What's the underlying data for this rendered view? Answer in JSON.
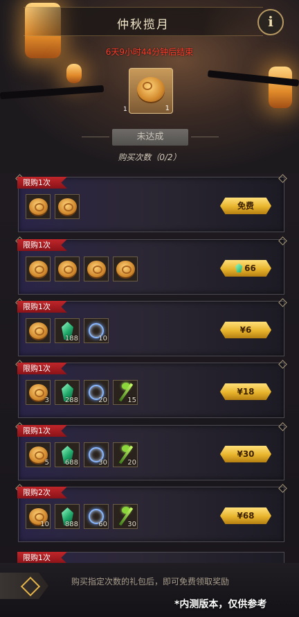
{
  "header": {
    "title": "仲秋揽月"
  },
  "event": {
    "countdown": "6天9小时44分钟后结束",
    "reward_count": "1",
    "reward_small": "1",
    "status": "未达成",
    "buy_count": "购买次数（0/2）"
  },
  "packs": [
    {
      "limit": "限购1次",
      "price": "免费",
      "items": [
        {
          "icon": "mooncake-icon",
          "qty": ""
        },
        {
          "icon": "mooncake-icon",
          "qty": ""
        }
      ]
    },
    {
      "limit": "限购1次",
      "price": "66",
      "price_icon": "gem-icon",
      "items": [
        {
          "icon": "mooncake-icon",
          "qty": ""
        },
        {
          "icon": "mooncake-icon",
          "qty": ""
        },
        {
          "icon": "mooncake-icon",
          "qty": ""
        },
        {
          "icon": "mooncake-icon",
          "qty": ""
        }
      ]
    },
    {
      "limit": "限购1次",
      "price": "¥6",
      "items": [
        {
          "icon": "mooncake-icon",
          "qty": ""
        },
        {
          "icon": "gem-icon",
          "qty": "188"
        },
        {
          "icon": "orb-icon",
          "qty": "10"
        }
      ]
    },
    {
      "limit": "限购1次",
      "price": "¥18",
      "items": [
        {
          "icon": "mooncake-icon",
          "qty": "3"
        },
        {
          "icon": "gem-icon",
          "qty": "288"
        },
        {
          "icon": "orb-icon",
          "qty": "20"
        },
        {
          "icon": "staff-icon",
          "qty": "15"
        }
      ]
    },
    {
      "limit": "限购1次",
      "price": "¥30",
      "items": [
        {
          "icon": "mooncake-icon",
          "qty": "5"
        },
        {
          "icon": "gem-icon",
          "qty": "688"
        },
        {
          "icon": "orb-icon",
          "qty": "30"
        },
        {
          "icon": "staff-icon",
          "qty": "20"
        }
      ]
    },
    {
      "limit": "限购2次",
      "price": "¥68",
      "items": [
        {
          "icon": "mooncake-icon",
          "qty": "10"
        },
        {
          "icon": "gem-icon",
          "qty": "888"
        },
        {
          "icon": "orb-icon",
          "qty": "60"
        },
        {
          "icon": "staff-icon",
          "qty": "30"
        }
      ]
    }
  ],
  "peek_card": {
    "limit": "限购1次"
  },
  "footer": {
    "hint": "购买指定次数的礼包后，即可免费领取奖励",
    "watermark": "*内测版本，仅供参考"
  },
  "colors": {
    "countdown": "#ff3b2b",
    "limit_tag": "#c0262a",
    "price_button": "#e8b42c",
    "gem": "#1fa86a"
  }
}
